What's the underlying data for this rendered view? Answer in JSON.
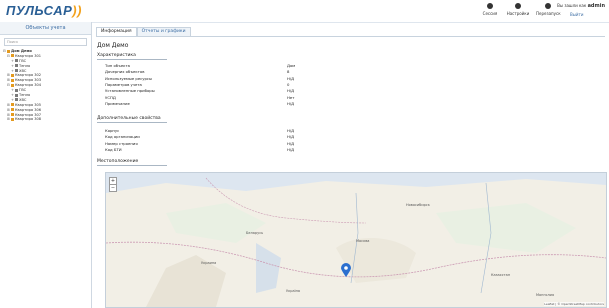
{
  "header": {
    "logo": "ПУЛЬСАР",
    "buttons": [
      {
        "label": "Сессия",
        "icon": "person-icon"
      },
      {
        "label": "Настройки",
        "icon": "gear-icon"
      },
      {
        "label": "Перезапуск",
        "icon": "refresh-icon"
      }
    ],
    "user_prefix": "Вы зашли как",
    "user_name": "admin",
    "logout": "Выйти"
  },
  "sidebar": {
    "title": "Объекты учета",
    "search_placeholder": "Поиск",
    "tree": [
      {
        "label": "Дом Демо",
        "level": 0,
        "type": "house",
        "expander": "⊟"
      },
      {
        "label": "Квартира 301",
        "level": 1,
        "type": "house",
        "expander": "⊟"
      },
      {
        "label": "ГВС",
        "level": 2,
        "type": "meter",
        "expander": "+"
      },
      {
        "label": "Тепло",
        "level": 2,
        "type": "meter",
        "expander": "+"
      },
      {
        "label": "ХВС",
        "level": 2,
        "type": "meter",
        "expander": "+"
      },
      {
        "label": "Квартира 302",
        "level": 1,
        "type": "house",
        "expander": "⊞"
      },
      {
        "label": "Квартира 303",
        "level": 1,
        "type": "house",
        "expander": "⊞"
      },
      {
        "label": "Квартира 304",
        "level": 1,
        "type": "house",
        "expander": "⊟"
      },
      {
        "label": "ГВС",
        "level": 2,
        "type": "meter",
        "expander": "+"
      },
      {
        "label": "Тепло",
        "level": 2,
        "type": "meter",
        "expander": "+"
      },
      {
        "label": "ХВС",
        "level": 2,
        "type": "meter",
        "expander": "+"
      },
      {
        "label": "Квартира 305",
        "level": 1,
        "type": "house",
        "expander": "⊞"
      },
      {
        "label": "Квартира 306",
        "level": 1,
        "type": "house",
        "expander": "⊞"
      },
      {
        "label": "Квартира 307",
        "level": 1,
        "type": "house",
        "expander": "⊞"
      },
      {
        "label": "Квартира 308",
        "level": 1,
        "type": "house",
        "expander": "⊞"
      }
    ]
  },
  "tabs": [
    {
      "label": "Информация",
      "active": true
    },
    {
      "label": "Отчеты и графики",
      "active": false
    }
  ],
  "page_title": "Дом Демо",
  "characteristics": {
    "title": "Характеристика",
    "rows": [
      {
        "label": "Тип объекта",
        "value": "Дом"
      },
      {
        "label": "Дочерних объектов",
        "value": "8"
      },
      {
        "label": "Используемые ресурсы",
        "value": "Н/Д"
      },
      {
        "label": "Параметров учета",
        "value": "0"
      },
      {
        "label": "Установленные приборы",
        "value": "Н/Д"
      },
      {
        "label": "УСПД",
        "value": "Нет"
      },
      {
        "label": "Примечание",
        "value": "Н/Д"
      }
    ]
  },
  "extra": {
    "title": "Дополнительные свойства",
    "rows": [
      {
        "label": "Корпус",
        "value": "Н/Д"
      },
      {
        "label": "Код организации",
        "value": "Н/Д"
      },
      {
        "label": "Номер строения",
        "value": "Н/Д"
      },
      {
        "label": "Код БТИ",
        "value": "Н/Д"
      }
    ]
  },
  "location": {
    "title": "Местоположение",
    "zoom_in": "+",
    "zoom_out": "−",
    "attribution": "Leaflet | © OpenStreetMap contributors",
    "map_labels": [
      {
        "text": "Москва"
      },
      {
        "text": "Казахстан"
      },
      {
        "text": "Беларусь"
      },
      {
        "text": "Украина"
      },
      {
        "text": "Україна"
      },
      {
        "text": "Монголия"
      },
      {
        "text": "Новосибирск"
      }
    ]
  },
  "colors": {
    "accent": "#3a6ca3",
    "logo_blue": "#2a5f95",
    "logo_orange": "#f2a11b",
    "map_water": "#dde6f0",
    "map_land": "#f2efe6",
    "marker": "#2b6fcf"
  }
}
